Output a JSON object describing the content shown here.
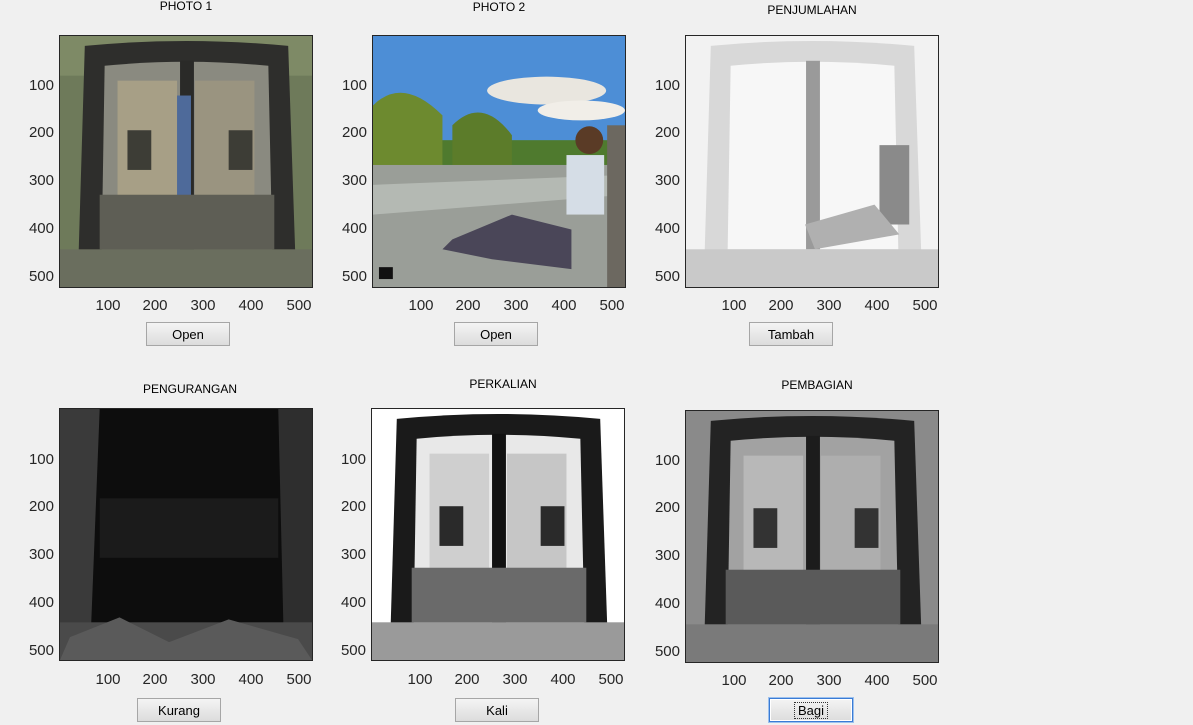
{
  "panels": [
    {
      "title": "PHOTO 1",
      "button": "Open",
      "scene": "door-color"
    },
    {
      "title": "PHOTO 2",
      "button": "Open",
      "scene": "park"
    },
    {
      "title": "PENJUMLAHAN",
      "button": "Tambah",
      "scene": "bright-blend"
    },
    {
      "title": "PENGURANGAN",
      "button": "Kurang",
      "scene": "dark"
    },
    {
      "title": "PERKALIAN",
      "button": "Kali",
      "scene": "high-contrast"
    },
    {
      "title": "PEMBAGIAN",
      "button": "Bagi",
      "scene": "gray-door"
    }
  ],
  "axis": {
    "yticks": [
      "100",
      "200",
      "300",
      "400",
      "500"
    ],
    "xticks": [
      "100",
      "200",
      "300",
      "400",
      "500"
    ]
  }
}
